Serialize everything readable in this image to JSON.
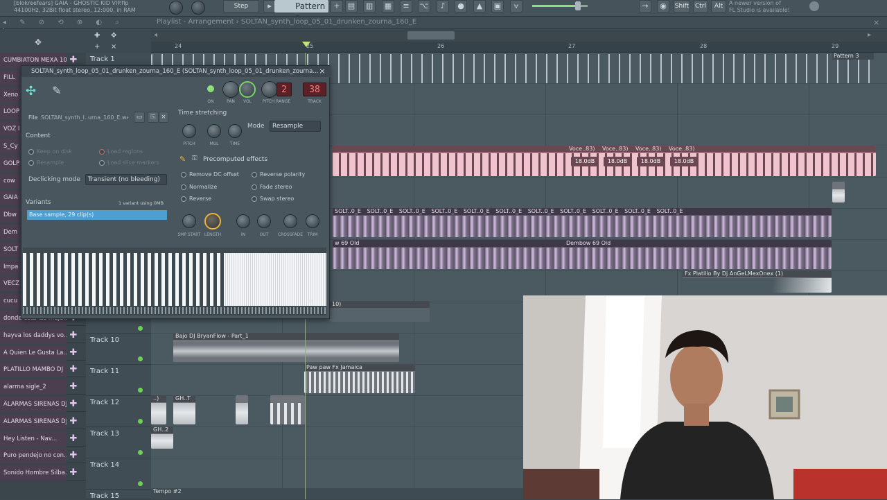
{
  "toolbar": {
    "info_line1": "[blokreefears] GAIA - GHOSTIC KID VIP.flp",
    "info_line2": "44100Hz, 32Bit float stereo, 12:000, in RAM",
    "step_label": "Step",
    "pattern_label": "Pattern 3",
    "shift_label": "Shift",
    "ctrl_label": "Ctrl",
    "alt_label": "Alt",
    "update_line1": "A newer version of",
    "update_line2": "FL Studio is available!",
    "master_volume_fraction": 0.82
  },
  "playlist": {
    "title": "Playlist - Arrangement  ›  SOLTAN_synth_loop_05_01_drunken_zourna_160_E",
    "ruler_numbers": [
      "24",
      "25",
      "26",
      "27",
      "28",
      "29"
    ],
    "pattern_tag": "Pattern 3",
    "channels": [
      "CUMBIATON MEXA 10...",
      "FILL",
      "Xeno",
      "LOOP",
      "VOZ I",
      "S_Cy",
      "GOLP",
      "cow",
      "GAIA",
      "Dbw",
      "Dem",
      "SOLT",
      "Impa",
      "VECZ",
      "cucu",
      "donde esta las muje...",
      "hayva los daddys vo...",
      "A Quien Le Gusta La...",
      "PLATILLO MAMBO DJ",
      "alarma sigle_2",
      "ALARMAS SIRENAS DJ...",
      "ALARMAS SIRENAS DJ...",
      "Hey Listen - Nav...",
      "Puro pendejo no con...",
      "Sonido Hombre Silba..."
    ],
    "tracks": [
      "Track 1",
      "Track 10",
      "Track 11",
      "Track 12",
      "Track 13",
      "Track 14",
      "Track 15"
    ],
    "clips": {
      "voces_label": "Voce..83)",
      "db_label": "18.0dB",
      "solt_label": "SOLT..0_E",
      "dembow_left": "w 69 Old",
      "dembow_right": "Dembow 69 Old",
      "platillo": "Fx Platillo By Dj AnGeLMexOnex (1)",
      "small_tag": "10)",
      "bajo": "Bajo DJ BryanFlow - Part_1",
      "paw": "Paw paw Fx Jamaica",
      "gh_a": "..)",
      "gh_b": "GH..T",
      "gh_c": "GH..2",
      "tempo": "Tempo #2"
    }
  },
  "popup": {
    "title": "SOLTAN_synth_loop_05_01_drunken_zourna_160_E (SOLTAN_synth_loop_05_01_drunken_zourna...",
    "knob_labels": {
      "on": "ON",
      "pan": "PAN",
      "vol": "VOL",
      "pitch": "PITCH RANGE",
      "track": "TRACK"
    },
    "pitch_range": "2",
    "track_number": "38",
    "file_label": "File",
    "file_name": "SOLTAN_synth_l..urna_160_E.wav",
    "content_label": "Content",
    "keep_on_disk": "Keep on disk",
    "load_regions": "Load regions",
    "resample": "Resample",
    "load_slice_markers": "Load slice markers",
    "declicking_label": "Declicking mode",
    "declicking_value": "Transient (no bleeding)",
    "time_stretching": "Time stretching",
    "ts_knobs": [
      "PITCH",
      "MUL",
      "TIME"
    ],
    "mode_label": "Mode",
    "mode_value": "Resample",
    "precomputed": "Precomputed effects",
    "effects": [
      "Remove DC offset",
      "Reverse polarity",
      "Normalize",
      "Fade stereo",
      "Reverse",
      "Swap stereo"
    ],
    "variants_label": "Variants",
    "variants_info": "1 variant using 0MB",
    "variant_row": "Base sample, 29 clip(s)",
    "fx_knobs": [
      "SMP START",
      "LENGTH",
      "IN",
      "OUT",
      "CROSSFADE",
      "TRIM"
    ],
    "wave_tag": "32"
  },
  "colors": {
    "clip_pink": "#dca4b3",
    "clip_purple": "#5a5460",
    "accent_green": "#77d56a",
    "knob_yellow": "#f0b338",
    "lcd_red": "#ff7b7b"
  }
}
